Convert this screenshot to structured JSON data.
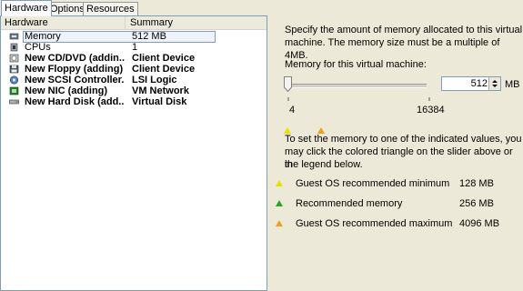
{
  "tabs": [
    "Hardware",
    "Options",
    "Resources"
  ],
  "hardware_list": {
    "columns": [
      "Hardware",
      "Summary"
    ],
    "rows": [
      {
        "name": "Memory",
        "summary": "512 MB",
        "icon": "memory-icon"
      },
      {
        "name": "CPUs",
        "summary": "1",
        "icon": "cpu-icon"
      },
      {
        "name": "New CD/DVD (addin...",
        "summary": "Client Device",
        "icon": "cd-dvd-icon"
      },
      {
        "name": "New Floppy (adding)",
        "summary": "Client Device",
        "icon": "floppy-icon"
      },
      {
        "name": "New SCSI Controller...",
        "summary": "LSI Logic",
        "icon": "scsi-controller-icon"
      },
      {
        "name": "New NIC (adding)",
        "summary": "VM Network",
        "icon": "nic-icon"
      },
      {
        "name": "New Hard Disk (add...",
        "summary": "Virtual Disk",
        "icon": "hard-disk-icon"
      }
    ]
  },
  "memory_panel": {
    "description_line1": "Specify the amount of memory allocated to this virtual",
    "description_line2": "machine. The memory size must be a multiple of 4MB.",
    "memory_label": "Memory for this virtual machine:",
    "slider_min_label": "4",
    "slider_max_label": "16384",
    "slider_value": 512,
    "spin_value": "512",
    "unit": "MB",
    "hint_line1": "To set the memory to one of the indicated values, you",
    "hint_line2": "may click the colored triangle on the slider above or in",
    "hint_line3": "the legend below.",
    "legend": [
      {
        "label": "Guest OS recommended minimum",
        "amount": "128 MB",
        "color": "#e8e000"
      },
      {
        "label": "Recommended memory",
        "amount": "256 MB",
        "color": "#2ea02e"
      },
      {
        "label": "Guest OS recommended maximum",
        "amount": "4096 MB",
        "color": "#f0a020"
      }
    ]
  }
}
